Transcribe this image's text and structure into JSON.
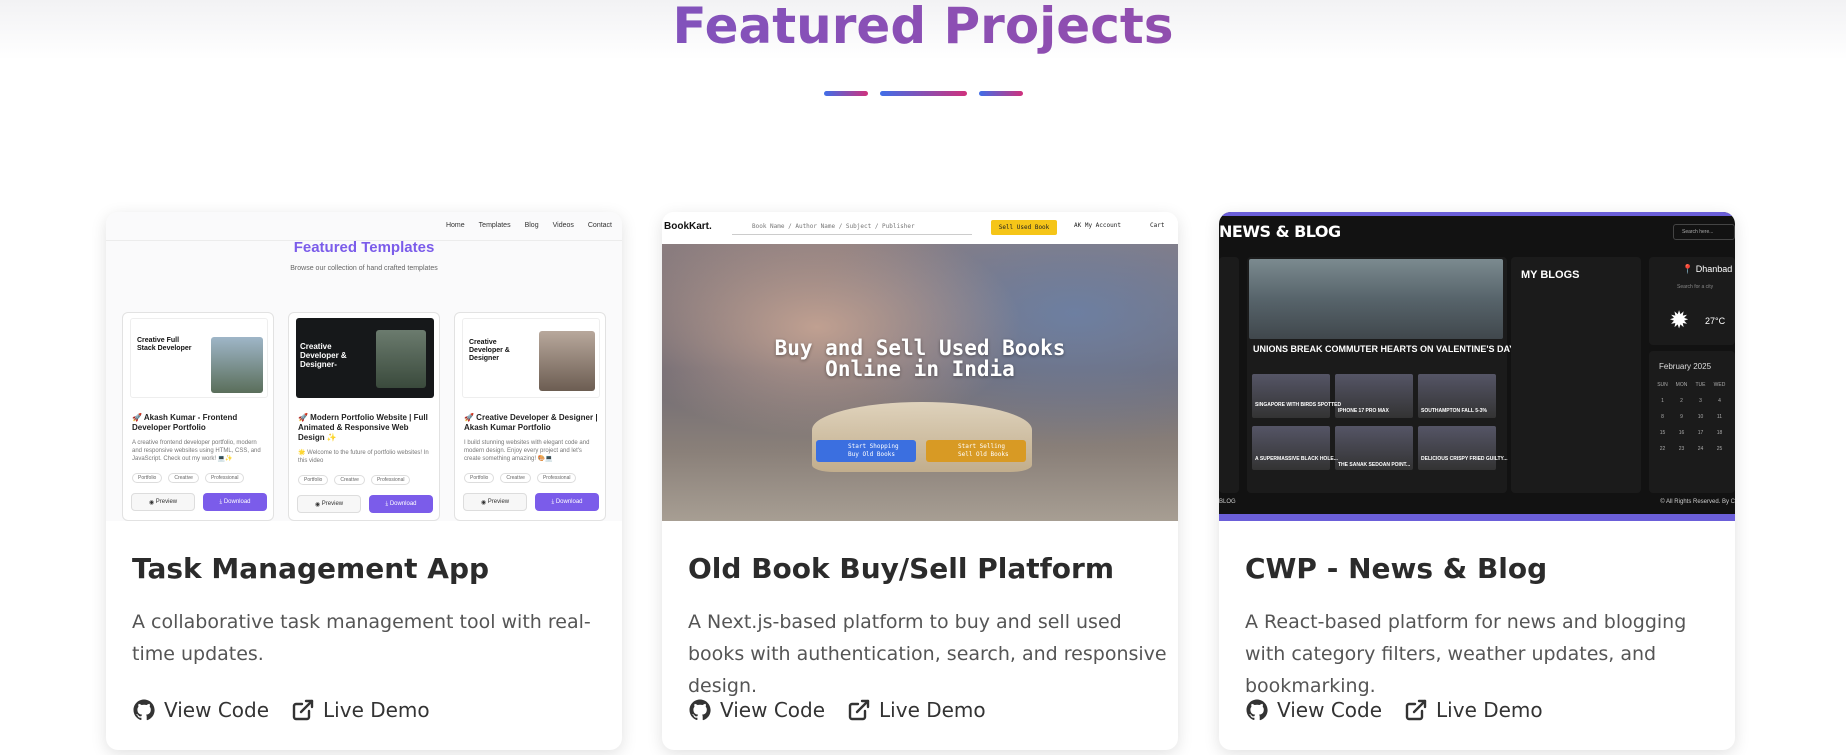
{
  "section": {
    "title": "Featured Projects"
  },
  "projects": [
    {
      "title": "Task Management App",
      "description": "A collaborative task management tool with real-time updates.",
      "view_code": "View Code",
      "live_demo": "Live Demo",
      "thumbnail": {
        "nav": [
          "Home",
          "Templates",
          "Blog",
          "Videos",
          "Contact"
        ],
        "heading": "Featured Templates",
        "subheading": "Browse our collection of hand crafted templates",
        "templates": [
          {
            "shot_title": "Creative Full Stack Developer",
            "title": "🚀 Akash Kumar - Frontend Developer Portfolio",
            "desc": "A creative frontend developer portfolio, modern and responsive websites using HTML, CSS, and JavaScript. Check out my work! 💻✨",
            "tags": [
              "Portfolio",
              "Creative",
              "Professional"
            ],
            "preview": "Preview",
            "download": "Download"
          },
          {
            "shot_title": "Creative Developer & Designer-",
            "title": "🚀 Modern Portfolio Website | Full Animated & Responsive Web Design ✨",
            "desc": "🌟 Welcome to the future of portfolio websites! In this video",
            "tags": [
              "Portfolio",
              "Creative",
              "Professional"
            ],
            "preview": "Preview",
            "download": "Download"
          },
          {
            "shot_title": "Creative Developer & Designer",
            "title": "🚀 Creative Developer & Designer | Akash Kumar Portfolio",
            "desc": "I build stunning websites with elegant code and modern design. Enjoy every project and let's create something amazing! 🎨💻",
            "tags": [
              "Portfolio",
              "Creative",
              "Professional"
            ],
            "preview": "Preview",
            "download": "Download"
          }
        ]
      }
    },
    {
      "title": "Old Book Buy/Sell Platform",
      "description": "A Next.js-based platform to buy and sell used books with authentication, search, and responsive design.",
      "view_code": "View Code",
      "live_demo": "Live Demo",
      "thumbnail": {
        "logo": "BookKart.",
        "search_placeholder": "Book Name / Author Name / Subject / Publisher",
        "sell_button": "Sell Used Book",
        "account": "AK  My Account",
        "cart": "Cart",
        "hero_line1": "Buy and Sell Used Books",
        "hero_line2": "Online in India",
        "btn_shop": "Start Shopping\nBuy Old Books",
        "btn_sell": "Start Selling\nSell Old Books"
      }
    },
    {
      "title": "CWP - News & Blog",
      "description": "A React-based platform for news and blogging with category filters, weather updates, and bookmarking.",
      "view_code": "View Code",
      "live_demo": "Live Demo",
      "thumbnail": {
        "header": "NEWS & BLOG",
        "search": "Search here...",
        "headline": "UNIONS BREAK COMMUTER HEARTS ON VALENTINE'S DAY",
        "small_headlines": [
          "SINGAPORE WITH BIRDS SPOTTED",
          "IPHONE 17 PRO MAX",
          "SOUTHAMPTON FALL 5-3%",
          "A SUPERMASSIVE BLACK HOLE...",
          "THE SANAK SEDOAN POINT...",
          "DELICIOUS CRISPY FRIED GUILTY..."
        ],
        "my_blogs": "MY BLOGS",
        "city": "Dhanbad",
        "city_sub": "Search for a city",
        "temp": "27°C",
        "month": "February  2025",
        "cal_days": [
          "SUN",
          "MON",
          "TUE",
          "WED",
          "1",
          "2",
          "3",
          "4",
          "8",
          "9",
          "10",
          "11",
          "15",
          "16",
          "17",
          "18",
          "22",
          "23",
          "24",
          "25"
        ],
        "footer_left": "BLOG",
        "footer_right": "© All Rights Reserved. By C"
      }
    }
  ]
}
